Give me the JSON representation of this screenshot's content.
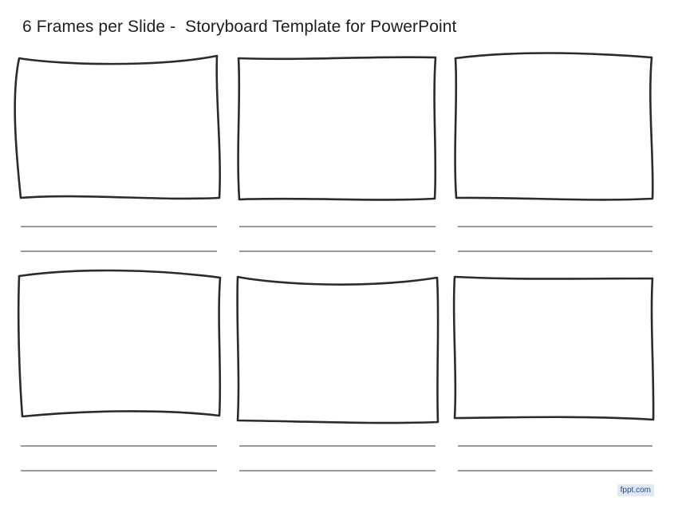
{
  "slide": {
    "title": "6 Frames per Slide -  Storyboard Template for PowerPoint",
    "watermark": "fppt.com"
  },
  "frames": [
    {
      "id": 1,
      "caption_lines": 2
    },
    {
      "id": 2,
      "caption_lines": 2
    },
    {
      "id": 3,
      "caption_lines": 2
    },
    {
      "id": 4,
      "caption_lines": 2
    },
    {
      "id": 5,
      "caption_lines": 2
    },
    {
      "id": 6,
      "caption_lines": 2
    }
  ],
  "colors": {
    "frame_stroke": "#2b2b2b",
    "caption_line": "#9a9a9a",
    "title_text": "#1f1f1f"
  }
}
